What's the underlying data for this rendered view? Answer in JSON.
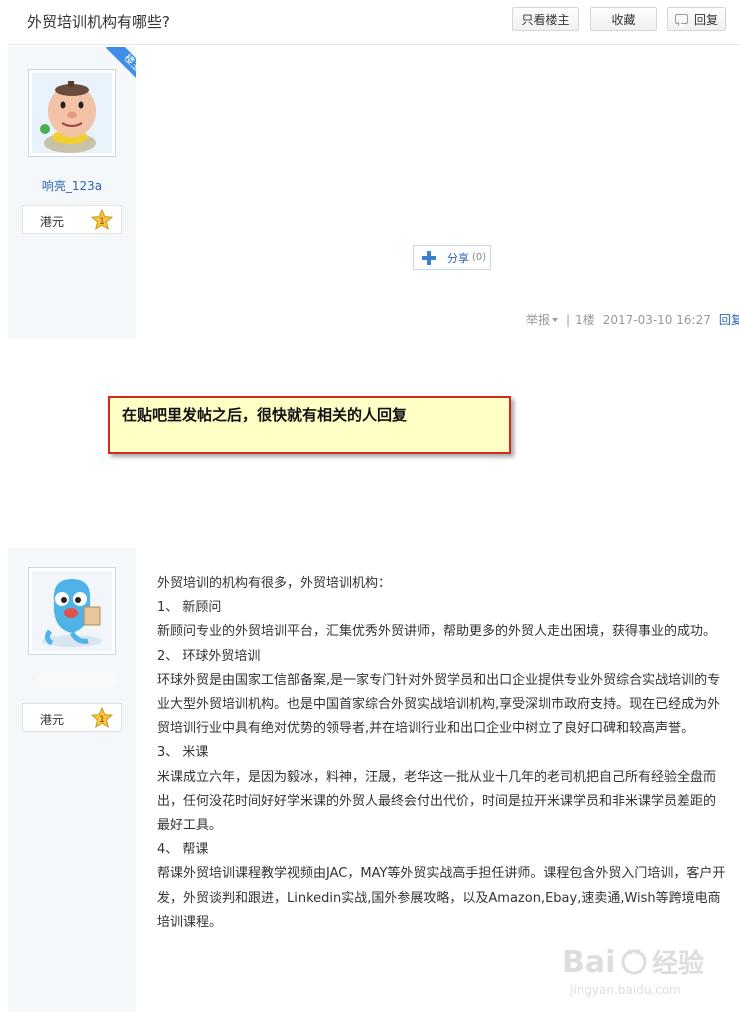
{
  "header": {
    "title": "外贸培训机构有哪些?",
    "buttons": {
      "only_op": "只看楼主",
      "favorite": "收藏",
      "reply": "回复"
    }
  },
  "post1": {
    "badge": "楼主",
    "username": "响亮_123a",
    "level_label": "港元",
    "level_number": "1",
    "share_label": "分享",
    "share_count": "(0)",
    "report": "举报",
    "sep": "|",
    "floor": "1楼",
    "timestamp": "2017-03-10 16:27",
    "reply": "回复"
  },
  "annotation": "在贴吧里发帖之后，很快就有相关的人回复",
  "post2": {
    "level_label": "港元",
    "level_number": "1",
    "paragraphs": [
      "外贸培训的机构有很多，外贸培训机构：",
      "1、 新顾问",
      "新顾问专业的外贸培训平台，汇集优秀外贸讲师，帮助更多的外贸人走出困境，获得事业的成功。",
      "2、 环球外贸培训",
      "环球外贸是由国家工信部备案,是一家专门针对外贸学员和出口企业提供专业外贸综合实战培训的专业大型外贸培训机构。也是中国首家综合外贸实战培训机构,享受深圳市政府支持。现在已经成为外贸培训行业中具有绝对优势的领导者,并在培训行业和出口企业中树立了良好口碑和较高声誉。",
      "3、 米课",
      "米课成立六年，是因为毅冰，料神，汪晟，老华这一批从业十几年的老司机把自己所有经验全盘而出，任何没花时间好好学米课的外贸人最终会付出代价，时间是拉开米课学员和非米课学员差距的最好工具。",
      "4、 帮课",
      "帮课外贸培训课程教学视频由JAC，MAY等外贸实战高手担任讲师。课程包含外贸入门培训，客户开发，外贸谈判和跟进，Linkedin实战,国外参展攻略，以及Amazon,Ebay,速卖通,Wish等跨境电商培训课程。"
    ]
  },
  "watermark": {
    "brand": "Bai",
    "product": "经验",
    "url": "jingyan.baidu.com"
  },
  "colors": {
    "link": "#2d64b3",
    "sidebar": "#f5f8fb",
    "badge": "#3e8ee8",
    "note_bg": "#ffffc6",
    "note_border": "#d32a1d"
  }
}
